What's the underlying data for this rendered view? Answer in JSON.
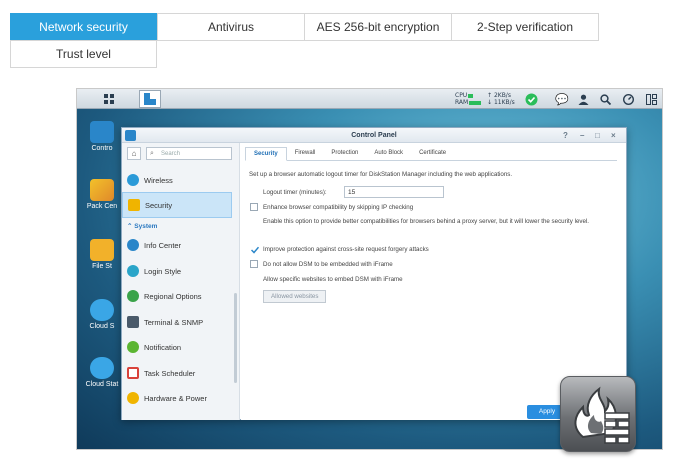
{
  "feature_tabs": [
    {
      "label": "Network security",
      "active": true
    },
    {
      "label": "Antivirus",
      "active": false
    },
    {
      "label": "AES 256-bit encryption",
      "active": false
    },
    {
      "label": "2-Step verification",
      "active": false
    },
    {
      "label": "Trust level",
      "active": false
    }
  ],
  "taskbar": {
    "resource_labels": [
      "CPU",
      "RAM"
    ],
    "net_up": "2KB/s",
    "net_down": "11KB/s"
  },
  "desktop_icons": [
    "Contro",
    "Pack Cen",
    "File St",
    "Cloud S",
    "Cloud Stat"
  ],
  "window": {
    "title": "Control Panel",
    "controls": [
      "?",
      "–",
      "□",
      "×"
    ]
  },
  "sidebar": {
    "search_placeholder": "Search",
    "section_header": "System",
    "items": [
      {
        "label": "Wireless",
        "icon": "wifi-icon",
        "selected": false,
        "color": "#2a9ad8"
      },
      {
        "label": "Security",
        "icon": "shield-icon",
        "selected": true,
        "color": "#f0b400"
      },
      {
        "label": "Info Center",
        "icon": "info-icon",
        "selected": false,
        "color": "#2a86c9"
      },
      {
        "label": "Login Style",
        "icon": "palette-icon",
        "selected": false,
        "color": "#2aa5c9"
      },
      {
        "label": "Regional Options",
        "icon": "globe-icon",
        "selected": false,
        "color": "#3aa34a"
      },
      {
        "label": "Terminal & SNMP",
        "icon": "terminal-icon",
        "selected": false,
        "color": "#4a5a6a"
      },
      {
        "label": "Notification",
        "icon": "chat-icon",
        "selected": false,
        "color": "#5bb532"
      },
      {
        "label": "Task Scheduler",
        "icon": "calendar-icon",
        "selected": false,
        "color": "#d9423b"
      },
      {
        "label": "Hardware & Power",
        "icon": "bulb-icon",
        "selected": false,
        "color": "#f0b400"
      }
    ]
  },
  "content": {
    "tabs": [
      {
        "label": "Security",
        "active": true
      },
      {
        "label": "Firewall",
        "active": false
      },
      {
        "label": "Protection",
        "active": false
      },
      {
        "label": "Auto Block",
        "active": false
      },
      {
        "label": "Certificate",
        "active": false
      }
    ],
    "intro": "Set up a browser automatic logout timer for DiskStation Manager including the web applications.",
    "logout_label": "Logout timer (minutes):",
    "logout_value": "15",
    "opt_ip_check": "Enhance browser compatibility by skipping IP checking",
    "opt_ip_check_desc": "Enable this option to provide better compatibilities for browsers behind a proxy server, but it will lower the security level.",
    "opt_csrf": "Improve protection against cross-site request forgery attacks",
    "opt_iframe": "Do not allow DSM to be embedded with iFrame",
    "allow_sites_text": "Allow specific websites to embed DSM with iFrame",
    "allowed_button": "Allowed websites",
    "apply_button": "Apply"
  },
  "colors": {
    "accent": "#2aa0dc",
    "apply": "#2a8ee0"
  }
}
